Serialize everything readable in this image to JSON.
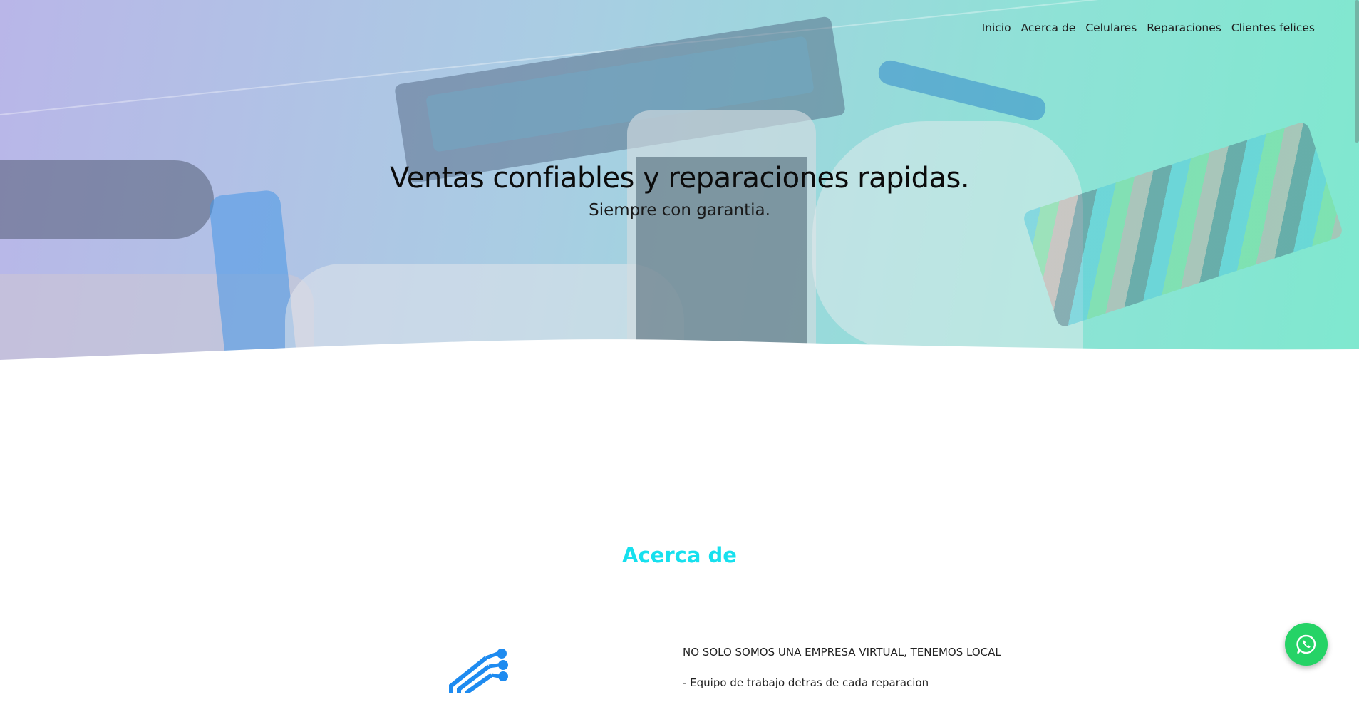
{
  "nav": {
    "items": [
      {
        "label": "Inicio"
      },
      {
        "label": "Acerca de"
      },
      {
        "label": "Celulares"
      },
      {
        "label": "Reparaciones"
      },
      {
        "label": "Clientes felices"
      }
    ]
  },
  "hero": {
    "title": "Ventas confiables y reparaciones rapidas.",
    "subtitle": "Siempre con garantia."
  },
  "about": {
    "title": "Acerca de",
    "lines": [
      "NO SOLO SOMOS UNA EMPRESA VIRTUAL, TENEMOS LOCAL",
      "- Equipo de trabajo detras de cada reparacion"
    ],
    "logo_icon": "circuit-logo-icon"
  },
  "whatsapp": {
    "icon": "whatsapp-icon",
    "color": "#25d366"
  },
  "colors": {
    "accent": "#16e0ee",
    "hero_gradient_start": "#b9b6e8",
    "hero_gradient_end": "#7fe8cf"
  }
}
